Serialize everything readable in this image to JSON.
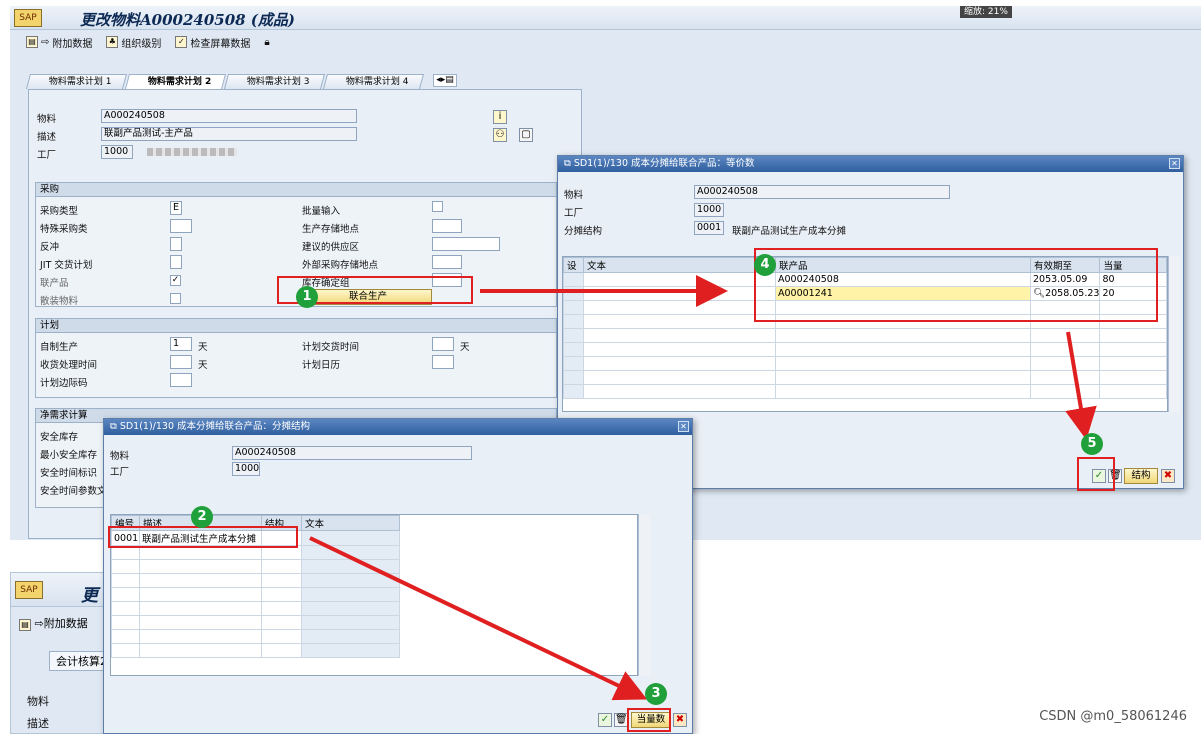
{
  "main": {
    "title": "更改物料A000240508 (成品)",
    "zoom_tag": "缩放: 21%",
    "toolbar": [
      "附加数据",
      "组织级别",
      "检查屏幕数据"
    ],
    "tabs": [
      "物料需求计划 1",
      "物料需求计划 2",
      "物料需求计划 3",
      "物料需求计划 4"
    ],
    "material_label": "物料",
    "material_value": "A000240508",
    "desc_label": "描述",
    "desc_value": "联副产品测试-主产品",
    "plant_label": "工厂",
    "plant_value": "1000",
    "procurement": {
      "header": "采购",
      "proc_type_label": "采购类型",
      "proc_type_value": "E",
      "special_label": "特殊采购类",
      "backflush_label": "反冲",
      "jit_label": "JIT 交货计划",
      "coproduct_label": "联产品",
      "coproduct_value": "✓",
      "bulk_label": "散装物料",
      "batch_entry_label": "批量输入",
      "prod_sloc_label": "生产存储地点",
      "supply_area_label": "建议的供应区",
      "ext_sloc_label": "外部采购存储地点",
      "stock_group_label": "库存确定组",
      "joint_prod_button": "联合生产"
    },
    "planning": {
      "header": "计划",
      "inhouse_label": "自制生产",
      "inhouse_value": "1",
      "inhouse_unit": "天",
      "gr_label": "收货处理时间",
      "gr_unit": "天",
      "margin_label": "计划边际码",
      "plan_delivery_label": "计划交货时间",
      "plan_delivery_unit": "天",
      "calendar_label": "计划日历"
    },
    "net_req": {
      "header": "净需求计算",
      "safety_label": "安全库存",
      "min_safety_label": "最小安全库存",
      "safety_time_label": "安全时间标识",
      "safety_param_label": "安全时间参数文"
    }
  },
  "dialog_apportion": {
    "title": "SD1(1)/130 成本分摊给联合产品：等价数",
    "material_label": "物料",
    "material_value": "A000240508",
    "plant_label": "工厂",
    "plant_value": "1000",
    "struct_label": "分摊结构",
    "struct_value": "0001",
    "struct_text": "联副产品测试生产成本分摊",
    "columns": [
      "设",
      "文本",
      "联产品",
      "有效期至",
      "当量"
    ],
    "rows": [
      {
        "product": "A000240508",
        "valid_to": "2053.05.09",
        "equiv": "80"
      },
      {
        "product": "A00001241",
        "valid_to": "2058.05.23",
        "equiv": "20"
      }
    ],
    "struct_button": "结构"
  },
  "dialog_structure": {
    "title": "SD1(1)/130 成本分摊给联合产品：分摊结构",
    "material_label": "物料",
    "material_value": "A000240508",
    "plant_label": "工厂",
    "plant_value": "1000",
    "columns": [
      "编号",
      "描述",
      "结构",
      "文本"
    ],
    "rows": [
      {
        "id": "0001",
        "desc": "联副产品测试生产成本分摊"
      }
    ],
    "equiv_button": "当量数"
  },
  "bg_window": {
    "title": "更",
    "toolbar": "附加数据",
    "tab": "会计核算2",
    "material_label": "物料",
    "desc_label": "描述"
  },
  "steps": [
    "1",
    "2",
    "3",
    "4",
    "5"
  ],
  "watermark": "CSDN @m0_58061246",
  "colors": {
    "accent_red": "#e02020",
    "step_green": "#20a03a",
    "title_blue": "#2f5f9f"
  }
}
